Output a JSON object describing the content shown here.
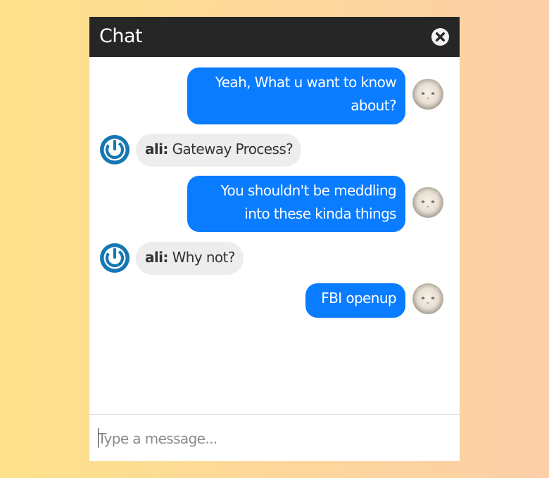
{
  "header": {
    "title": "Chat",
    "close_icon": "close-circle-icon"
  },
  "messages": [
    {
      "direction": "out",
      "lines": [
        "Yeah, What u want to know",
        "about?"
      ],
      "avatar": "cat-avatar"
    },
    {
      "direction": "in",
      "sender": "ali:",
      "text": "Gateway Process?",
      "avatar": "power-icon"
    },
    {
      "direction": "out",
      "lines": [
        "You shouldn't be meddling",
        "into these kinda things"
      ],
      "avatar": "cat-avatar"
    },
    {
      "direction": "in",
      "sender": "ali:",
      "text": "Why not?",
      "avatar": "power-icon"
    },
    {
      "direction": "out",
      "lines": [
        "FBI openup"
      ],
      "avatar": "cat-avatar"
    }
  ],
  "composer": {
    "placeholder": "Type a message..."
  },
  "colors": {
    "header_bg": "#262626",
    "outgoing_bubble": "#0a7cff",
    "incoming_bubble": "#ededed",
    "bot_icon": "#1577b4"
  }
}
